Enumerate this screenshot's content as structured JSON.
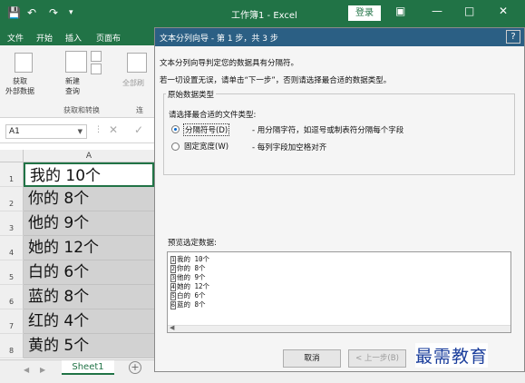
{
  "titlebar": {
    "title": "工作簿1 - Excel",
    "login_label": "登录",
    "save_icon": "save-icon",
    "undo_icon": "undo-icon",
    "redo_icon": "redo-icon"
  },
  "ribbon": {
    "tabs": [
      "文件",
      "开始",
      "插入",
      "页面布"
    ],
    "get_data_label": "获取\n外部数据",
    "new_query_label": "新建\n查询",
    "refresh_label": "全部刷",
    "group_get_transform": "获取和转换",
    "group_connect": "连"
  },
  "formula": {
    "namebox": "A1"
  },
  "grid": {
    "col_a": "A",
    "rows": [
      {
        "num": "1",
        "value": "我的 10个"
      },
      {
        "num": "2",
        "value": "你的 8个"
      },
      {
        "num": "3",
        "value": "他的 9个"
      },
      {
        "num": "4",
        "value": "她的 12个"
      },
      {
        "num": "5",
        "value": "白的 6个"
      },
      {
        "num": "6",
        "value": "蓝的 8个"
      },
      {
        "num": "7",
        "value": "红的 4个"
      },
      {
        "num": "8",
        "value": "黄的 5个"
      }
    ],
    "sheet_tab": "Sheet1"
  },
  "dialog": {
    "title": "文本分列向导 - 第 1 步，共 3 步",
    "line1": "文本分列向导判定您的数据具有分隔符。",
    "line2": "若一切设置无误，请单击“下一步”，否则请选择最合适的数据类型。",
    "group_label": "原始数据类型",
    "choose_label": "请选择最合适的文件类型:",
    "options": [
      {
        "label": "分隔符号(D)",
        "desc": "- 用分隔字符，如逗号或制表符分隔每个字段",
        "selected": true
      },
      {
        "label": "固定宽度(W)",
        "desc": "- 每列字段加空格对齐",
        "selected": false
      }
    ],
    "preview_label": "预览选定数据:",
    "preview_lines": [
      {
        "num": "1",
        "text": "我的 10个"
      },
      {
        "num": "2",
        "text": "你的 8个"
      },
      {
        "num": "3",
        "text": "他的 9个"
      },
      {
        "num": "4",
        "text": "她的 12个"
      },
      {
        "num": "5",
        "text": "白的 6个"
      },
      {
        "num": "6",
        "text": "蓝的 8个"
      }
    ],
    "cancel_label": "取消",
    "back_label": "< 上一步(B)"
  },
  "watermark": "最需教育",
  "colors": {
    "excel_green": "#217346",
    "dialog_title": "#2b5f84",
    "watermark": "#1b3e9c"
  }
}
